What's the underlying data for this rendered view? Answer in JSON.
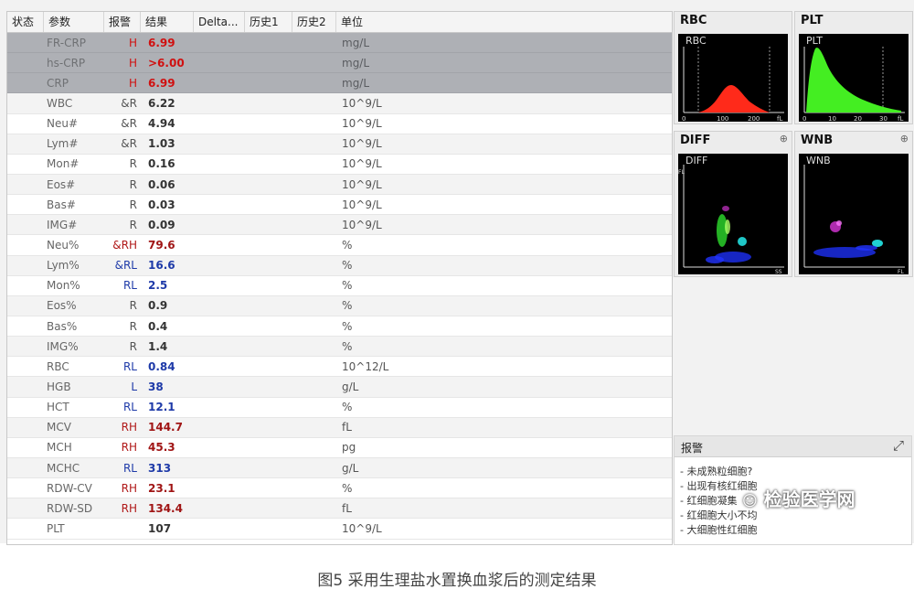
{
  "table": {
    "headers": [
      "状态",
      "参数",
      "报警",
      "结果",
      "Delta...",
      "历史1",
      "历史2",
      "单位"
    ],
    "rows": [
      {
        "param": "FR-CRP",
        "flag": "H",
        "result": "6.99",
        "unit": "mg/L",
        "flag_class": "H",
        "selected": true
      },
      {
        "param": "hs-CRP",
        "flag": "H",
        "result": ">6.00",
        "unit": "mg/L",
        "flag_class": "H",
        "selected": true
      },
      {
        "param": "CRP",
        "flag": "H",
        "result": "6.99",
        "unit": "mg/L",
        "flag_class": "H",
        "selected": true
      },
      {
        "param": "WBC",
        "flag": "&R",
        "result": "6.22",
        "unit": "10^9/L",
        "flag_class": "R"
      },
      {
        "param": "Neu#",
        "flag": "&R",
        "result": "4.94",
        "unit": "10^9/L",
        "flag_class": "R"
      },
      {
        "param": "Lym#",
        "flag": "&R",
        "result": "1.03",
        "unit": "10^9/L",
        "flag_class": "R"
      },
      {
        "param": "Mon#",
        "flag": "R",
        "result": "0.16",
        "unit": "10^9/L",
        "flag_class": "R"
      },
      {
        "param": "Eos#",
        "flag": "R",
        "result": "0.06",
        "unit": "10^9/L",
        "flag_class": "R"
      },
      {
        "param": "Bas#",
        "flag": "R",
        "result": "0.03",
        "unit": "10^9/L",
        "flag_class": "R"
      },
      {
        "param": "IMG#",
        "flag": "R",
        "result": "0.09",
        "unit": "10^9/L",
        "flag_class": "R"
      },
      {
        "param": "Neu%",
        "flag": "&RH",
        "result": "79.6",
        "unit": "%",
        "flag_class": "RH"
      },
      {
        "param": "Lym%",
        "flag": "&RL",
        "result": "16.6",
        "unit": "%",
        "flag_class": "RL"
      },
      {
        "param": "Mon%",
        "flag": "RL",
        "result": "2.5",
        "unit": "%",
        "flag_class": "RL"
      },
      {
        "param": "Eos%",
        "flag": "R",
        "result": "0.9",
        "unit": "%",
        "flag_class": "R"
      },
      {
        "param": "Bas%",
        "flag": "R",
        "result": "0.4",
        "unit": "%",
        "flag_class": "R"
      },
      {
        "param": "IMG%",
        "flag": "R",
        "result": "1.4",
        "unit": "%",
        "flag_class": "R"
      },
      {
        "param": "RBC",
        "flag": "RL",
        "result": "0.84",
        "unit": "10^12/L",
        "flag_class": "RL"
      },
      {
        "param": "HGB",
        "flag": "L",
        "result": "38",
        "unit": "g/L",
        "flag_class": "L"
      },
      {
        "param": "HCT",
        "flag": "RL",
        "result": "12.1",
        "unit": "%",
        "flag_class": "RL"
      },
      {
        "param": "MCV",
        "flag": "RH",
        "result": "144.7",
        "unit": "fL",
        "flag_class": "RH"
      },
      {
        "param": "MCH",
        "flag": "RH",
        "result": "45.3",
        "unit": "pg",
        "flag_class": "RH"
      },
      {
        "param": "MCHC",
        "flag": "RL",
        "result": "313",
        "unit": "g/L",
        "flag_class": "RL"
      },
      {
        "param": "RDW-CV",
        "flag": "RH",
        "result": "23.1",
        "unit": "%",
        "flag_class": "RH"
      },
      {
        "param": "RDW-SD",
        "flag": "RH",
        "result": "134.4",
        "unit": "fL",
        "flag_class": "RH"
      },
      {
        "param": "PLT",
        "flag": "",
        "result": "107",
        "unit": "10^9/L",
        "flag_class": ""
      }
    ]
  },
  "panels": {
    "rbc": {
      "title": "RBC",
      "plot_label": "RBC",
      "ticks": [
        "0",
        "100",
        "200",
        "fL"
      ],
      "color": "#ff2a1a"
    },
    "plt": {
      "title": "PLT",
      "plot_label": "PLT",
      "ticks": [
        "0",
        "10",
        "20",
        "30",
        "fL"
      ],
      "color": "#44ee22"
    },
    "diff": {
      "title": "DIFF",
      "plot_label": "DIFF",
      "x_label": "SS",
      "y_label": "FL"
    },
    "wnb": {
      "title": "WNB",
      "plot_label": "WNB",
      "x_label": "FL"
    }
  },
  "alarm": {
    "title": "报警",
    "lines": [
      "- 未成熟粒细胞?",
      "- 出现有核红细胞",
      "- 红细胞凝集",
      "- 红细胞大小不均",
      "- 大细胞性红细胞"
    ]
  },
  "icons": {
    "zoom": "magnifier-icon",
    "expand": "expand-icon",
    "wechat": "wechat-icon"
  },
  "watermark": "检验医学网",
  "caption": "图5 采用生理盐水置换血浆后的测定结果"
}
